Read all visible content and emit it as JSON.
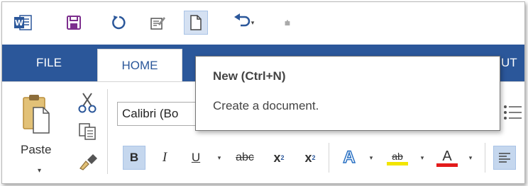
{
  "colors": {
    "accent": "#2b579a",
    "ribbon_bg": "#ffffff",
    "active_button_bg": "#d5e1f2"
  },
  "quick_access": {
    "items": [
      {
        "name": "word-app-icon"
      },
      {
        "name": "save-icon"
      },
      {
        "name": "refresh-icon"
      },
      {
        "name": "edit-document-icon"
      },
      {
        "name": "new-document-icon",
        "active": true
      },
      {
        "name": "undo-icon"
      },
      {
        "name": "customize-toolbar-icon"
      }
    ],
    "undo_arrow": "▾",
    "customize_glyph": "⩧"
  },
  "tabs": {
    "file": "FILE",
    "home": "HOME",
    "partial_tail": "UT"
  },
  "clipboard": {
    "paste_label": "Paste",
    "paste_arrow": "▾"
  },
  "font": {
    "name_box": "Calibri (Bo"
  },
  "formatting": {
    "bold": "B",
    "italic": "I",
    "underline": "U",
    "strikethrough": "abc",
    "subscript_base": "x",
    "subscript_sub": "2",
    "superscript_base": "x",
    "superscript_sup": "2",
    "text_effects": "A",
    "highlight": "ab",
    "font_color": "A",
    "dropdown": "▾",
    "highlight_color": "#f2e500",
    "font_color_bar": "#e31b1b"
  },
  "tooltip": {
    "title": "New (Ctrl+N)",
    "description": "Create a document."
  }
}
